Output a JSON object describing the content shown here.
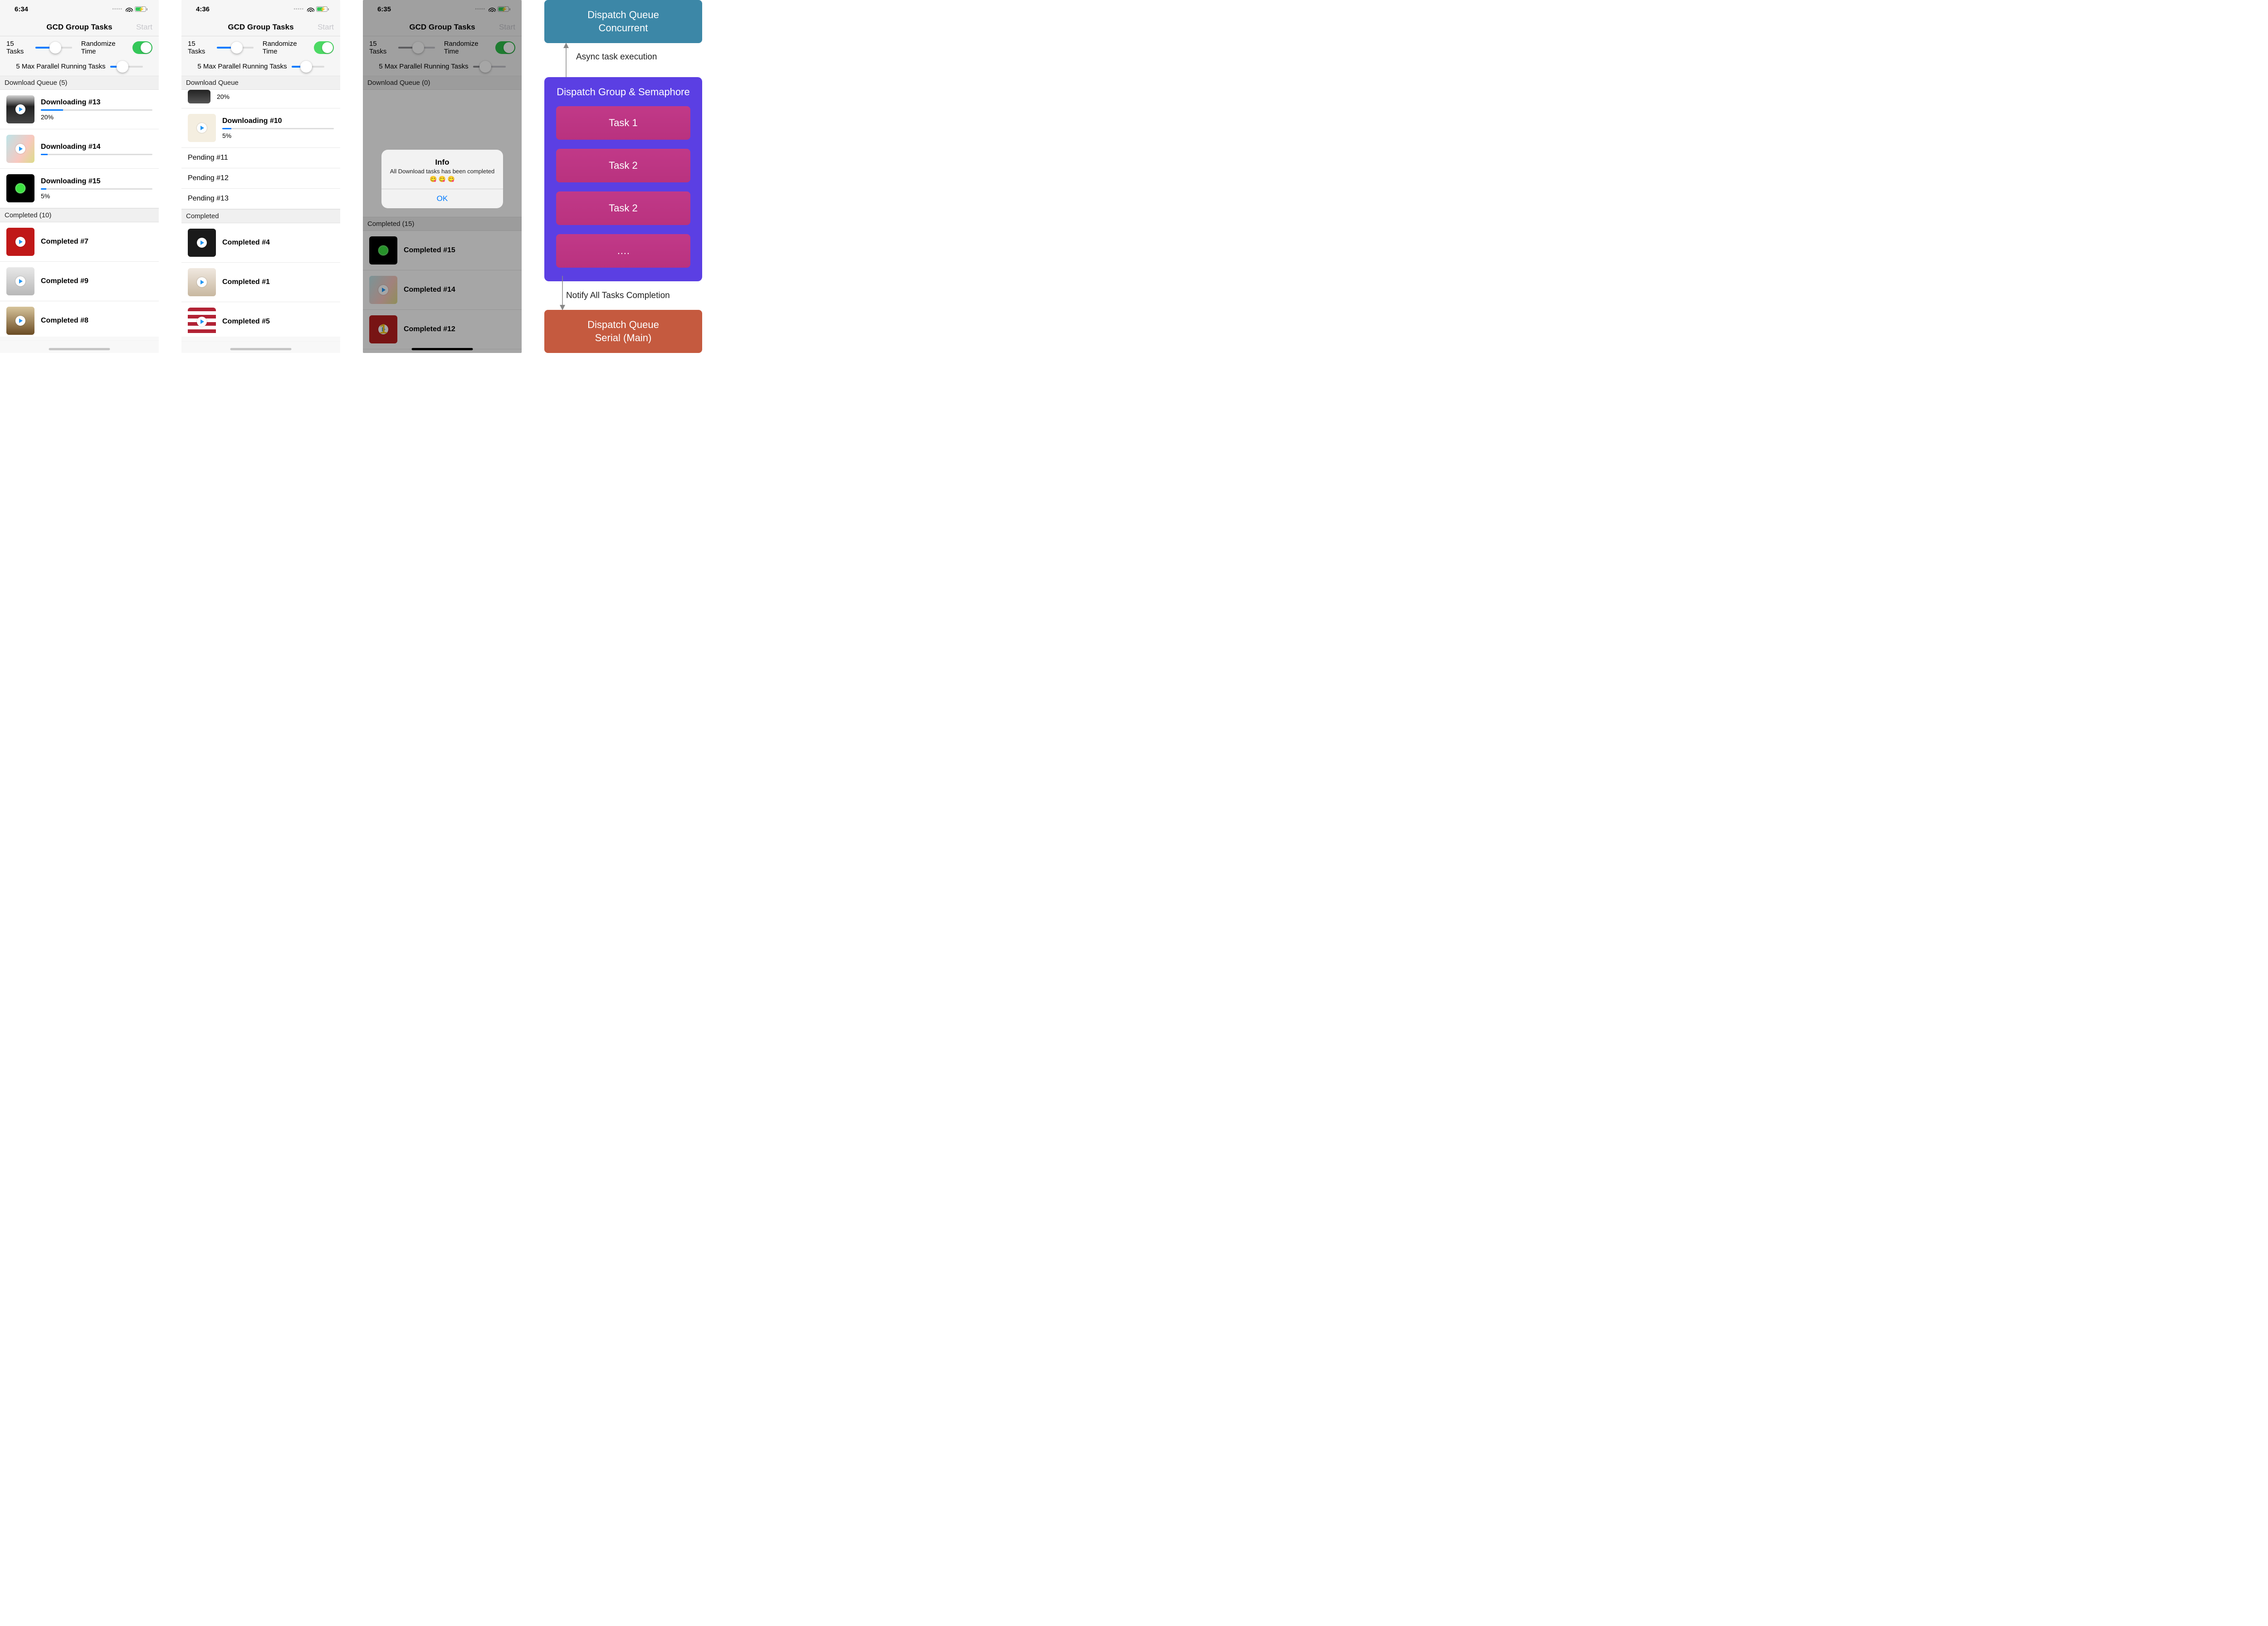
{
  "screens": [
    {
      "time": "6:34",
      "title": "GCD Group Tasks",
      "start": "Start",
      "tasks_label": "15 Tasks",
      "randomize": "Randomize Time",
      "max_parallel": "5 Max Parallel Running Tasks",
      "slider1_pct": 55,
      "slider2_pct": 38,
      "toggle_on": true,
      "section_download": "Download Queue (5)",
      "section_completed": "Completed (10)",
      "downloads": [
        {
          "title": "Downloading #13",
          "pct": "20%",
          "pctv": 20,
          "thumb": "t-buildings"
        },
        {
          "title": "Downloading #14",
          "pct": "",
          "pctv": 6,
          "thumb": "t-meghan"
        },
        {
          "title": "Downloading #15",
          "pct": "5%",
          "pctv": 5,
          "thumb": "t-bep"
        }
      ],
      "completed": [
        {
          "title": "Completed #7",
          "thumb": "t-red"
        },
        {
          "title": "Completed #9",
          "thumb": "t-dylan"
        },
        {
          "title": "Completed #8",
          "thumb": "t-legend"
        }
      ]
    },
    {
      "time": "4:36",
      "title": "GCD Group Tasks",
      "start": "Start",
      "tasks_label": "15 Tasks",
      "randomize": "Randomize Time",
      "max_parallel": "5 Max Parallel Running Tasks",
      "slider1_pct": 55,
      "slider2_pct": 45,
      "toggle_on": true,
      "section_download": "Download Queue",
      "section_completed": "Completed",
      "frag": {
        "pct": "20%",
        "thumb": "t-bw"
      },
      "downloads": [
        {
          "title": "Downloading #10",
          "pct": "5%",
          "pctv": 8,
          "thumb": "t-elton"
        }
      ],
      "pending": [
        "Pending #11",
        "Pending #12",
        "Pending #13"
      ],
      "completed": [
        {
          "title": "Completed #4",
          "thumb": "t-queen"
        },
        {
          "title": "Completed #1",
          "thumb": "t-girl"
        },
        {
          "title": "Completed #5",
          "thumb": "t-usa"
        }
      ]
    },
    {
      "time": "6:35",
      "title": "GCD Group Tasks",
      "start": "Start",
      "tasks_label": "15 Tasks",
      "randomize": "Randomize Time",
      "max_parallel": "5 Max Parallel Running Tasks",
      "slider1_pct": 55,
      "slider2_pct": 38,
      "toggle_on": true,
      "section_download": "Download Queue (0)",
      "section_completed": "Completed (15)",
      "alert": {
        "title": "Info",
        "msg": "All Download tasks has been completed 😋 😋 😋",
        "ok": "OK"
      },
      "completed": [
        {
          "title": "Completed #15",
          "thumb": "t-bep"
        },
        {
          "title": "Completed #14",
          "thumb": "t-meghan"
        },
        {
          "title": "Completed #12",
          "thumb": "t-one"
        }
      ]
    }
  ],
  "diagram": {
    "top": "Dispatch Queue\nConcurrent",
    "async_label": "Async task execution",
    "group_title": "Dispatch Group & Semaphore",
    "tasks": [
      "Task 1",
      "Task 2",
      "Task 2",
      "…."
    ],
    "notify_label": "Notify All Tasks Completion",
    "bottom": "Dispatch Queue\nSerial (Main)"
  }
}
